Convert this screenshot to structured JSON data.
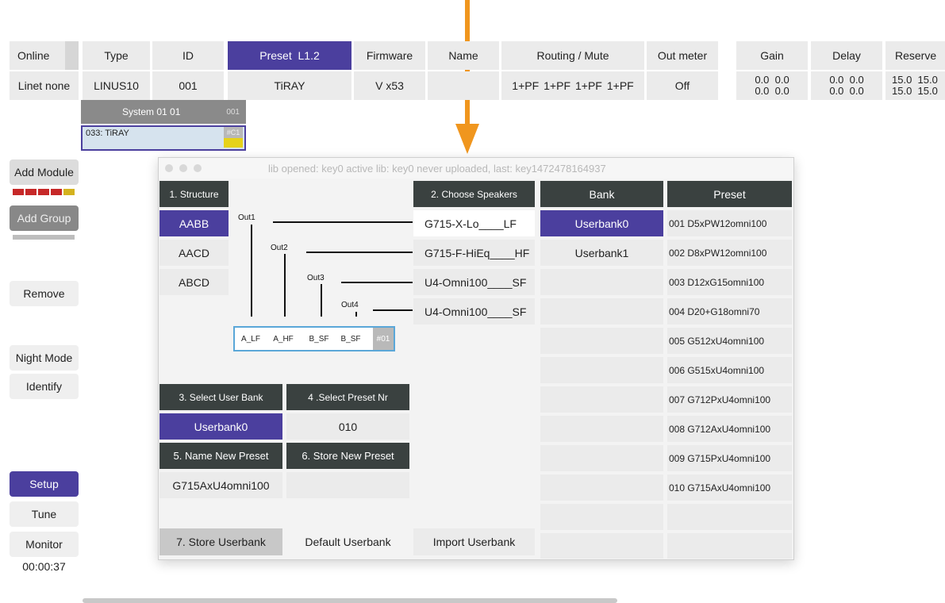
{
  "header": {
    "columns": [
      {
        "label": "Online",
        "value": "Linet none"
      },
      {
        "label": "Type",
        "value": "LINUS10"
      },
      {
        "label": "ID",
        "value": "001"
      },
      {
        "label": "Preset  L1.2",
        "value": "TiRAY"
      },
      {
        "label": "Firmware",
        "value": "V x53"
      },
      {
        "label": "Name",
        "value": ""
      },
      {
        "label": "Routing / Mute",
        "value": [
          "1+PF",
          "1+PF",
          "1+PF",
          "1+PF"
        ]
      },
      {
        "label": "Out meter",
        "value": "Off"
      },
      {
        "label": "Gain",
        "value": [
          "0.0  0.0",
          "0.0  0.0"
        ]
      },
      {
        "label": "Delay",
        "value": [
          "0.0  0.0",
          "0.0  0.0"
        ]
      },
      {
        "label": "Reserve",
        "value": [
          "15.0  15.0",
          "15.0  15.0"
        ]
      }
    ]
  },
  "system_block": {
    "title": "System 01 01",
    "code": "001",
    "device": "033: TiRAY",
    "device_code": "#C1"
  },
  "sidebar": {
    "add_module": "Add Module",
    "add_group": "Add Group",
    "remove": "Remove",
    "night_mode": "Night Mode",
    "identify": "Identify",
    "setup": "Setup",
    "tune": "Tune",
    "monitor": "Monitor",
    "timer": "00:00:37"
  },
  "dialog": {
    "title": "lib opened: key0 active lib: key0 never uploaded, last: key1472478164937",
    "structure_header": "1. Structure",
    "structures": [
      "AABB",
      "AACD",
      "ABCD"
    ],
    "outs": [
      "Out1",
      "Out2",
      "Out3",
      "Out4"
    ],
    "channels": [
      "A_LF",
      "A_HF",
      "B_SF",
      "B_SF",
      "#01"
    ],
    "speakers_header": "2. Choose Speakers",
    "speakers": [
      "G715-X-Lo____LF",
      "G715-F-HiEq____HF",
      "U4-Omni100____SF",
      "U4-Omni100____SF"
    ],
    "bank_header": "Bank",
    "banks": [
      "Userbank0",
      "Userbank1"
    ],
    "preset_header": "Preset",
    "presets": [
      "001 D5xPW12omni100",
      "002 D8xPW12omni100",
      "003 D12xG15omni100",
      "004 D20+G18omni70",
      "005 G512xU4omni100",
      "006 G515xU4omni100",
      "007 G712PxU4omni100",
      "008 G712AxU4omni100",
      "009 G715PxU4omni100",
      "010 G715AxU4omni100"
    ],
    "select_user_bank": "3. Select User Bank",
    "select_preset_nr": "4 .Select Preset Nr",
    "user_bank_value": "Userbank0",
    "preset_nr_value": "010",
    "name_new_preset": "5. Name New Preset",
    "store_new_preset": "6. Store New Preset",
    "preset_name_value": "G715AxU4omni100",
    "store_userbank": "7. Store Userbank",
    "default_userbank": "Default Userbank",
    "import_userbank": "Import Userbank"
  },
  "colors": {
    "accent_purple": "#4b3f9e",
    "dark_header": "#3a4140",
    "arrow_orange": "#f0961e"
  }
}
